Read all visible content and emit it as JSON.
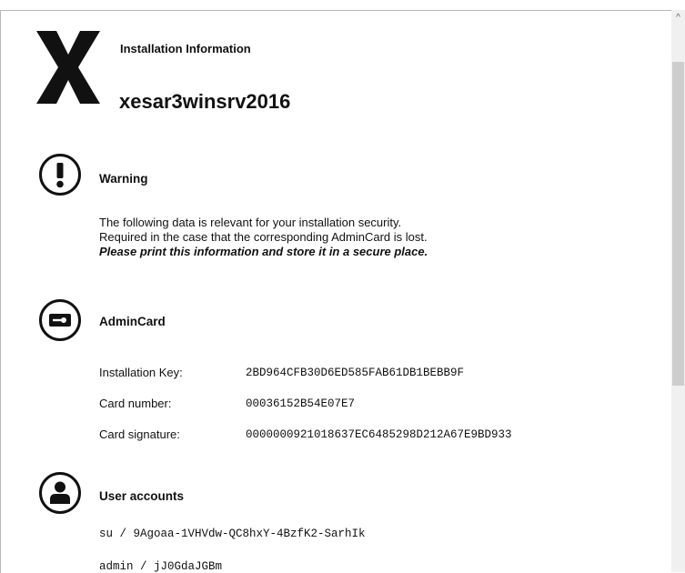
{
  "header": {
    "logo_letter": "X",
    "subtitle": "Installation Information",
    "title": "xesar3winsrv2016"
  },
  "warning": {
    "icon": "exclamation-icon",
    "title": "Warning",
    "line1": "The following data is relevant for your installation security.",
    "line2": "Required in the case that the corresponding AdminCard is lost.",
    "line3": "Please print this information and store it in a secure place."
  },
  "admin_card": {
    "icon": "key-card-icon",
    "title": "AdminCard",
    "rows": [
      {
        "label": "Installation Key:",
        "value": "2BD964CFB30D6ED585FAB61DB1BEBB9F"
      },
      {
        "label": "Card number:",
        "value": "00036152B54E07E7"
      },
      {
        "label": "Card signature:",
        "value": "0000000921018637EC6485298D212A67E9BD933"
      }
    ]
  },
  "user_accounts": {
    "icon": "user-icon",
    "title": "User accounts",
    "accounts": [
      "su / 9Agoaa-1VHVdw-QC8hxY-4BzfK2-SarhIk",
      "admin / jJ0GdaJGBm"
    ]
  },
  "scrollbar": {
    "up_arrow": "^"
  }
}
